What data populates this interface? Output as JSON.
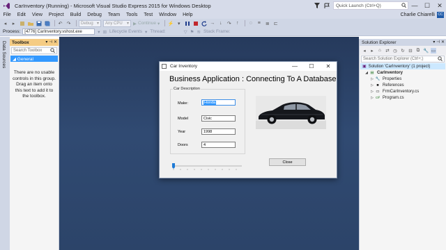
{
  "window": {
    "title": "CarInventory (Running) - Microsoft Visual Studio Express 2015 for Windows Desktop",
    "quick_launch_placeholder": "Quick Launch (Ctrl+Q)",
    "minimize": "—",
    "maximize": "☐",
    "close": "✕"
  },
  "menu": {
    "items": [
      "File",
      "Edit",
      "View",
      "Project",
      "Build",
      "Debug",
      "Team",
      "Tools",
      "Test",
      "Window",
      "Help"
    ],
    "user": "Charlie Chiarelli",
    "user_initials": "CC"
  },
  "toolbar": {
    "config": "Debug",
    "platform": "Any CPU",
    "continue_label": "Continue",
    "process_label": "Process:",
    "process_value": "[4776] CarInventory.vshost.exe",
    "lifecycle_label": "Lifecycle Events",
    "thread_label": "Thread:",
    "stack_frame_label": "Stack Frame:"
  },
  "left_tab": {
    "label": "Data Sources"
  },
  "toolbox": {
    "title": "Toolbox",
    "pin": "▾ ⊣ ✕",
    "search_placeholder": "Search Toolbox",
    "group": "◢ General",
    "empty_message": "There are no usable controls in this group. Drag an item onto this text to add it to the toolbox."
  },
  "app": {
    "title": "Car Inventory",
    "heading": "Business Application : Connecting To A Database",
    "group_caption": "Car Description",
    "fields": [
      {
        "label": "Make:",
        "value": "Honda",
        "selected": true
      },
      {
        "label": "Model",
        "value": "Civic"
      },
      {
        "label": "Year",
        "value": "1998"
      },
      {
        "label": "Doors",
        "value": "4"
      }
    ],
    "close_button": "Close"
  },
  "solution_explorer": {
    "title": "Solution Explorer",
    "pin": "▾ ⊣ ✕",
    "search_placeholder": "Search Solution Explorer (Ctrl+;)",
    "solution": "Solution 'CarInventory' (1 project)",
    "project": "CarInventory",
    "items": [
      "Properties",
      "References",
      "FrmCarInventory.cs",
      "Program.cs"
    ]
  }
}
